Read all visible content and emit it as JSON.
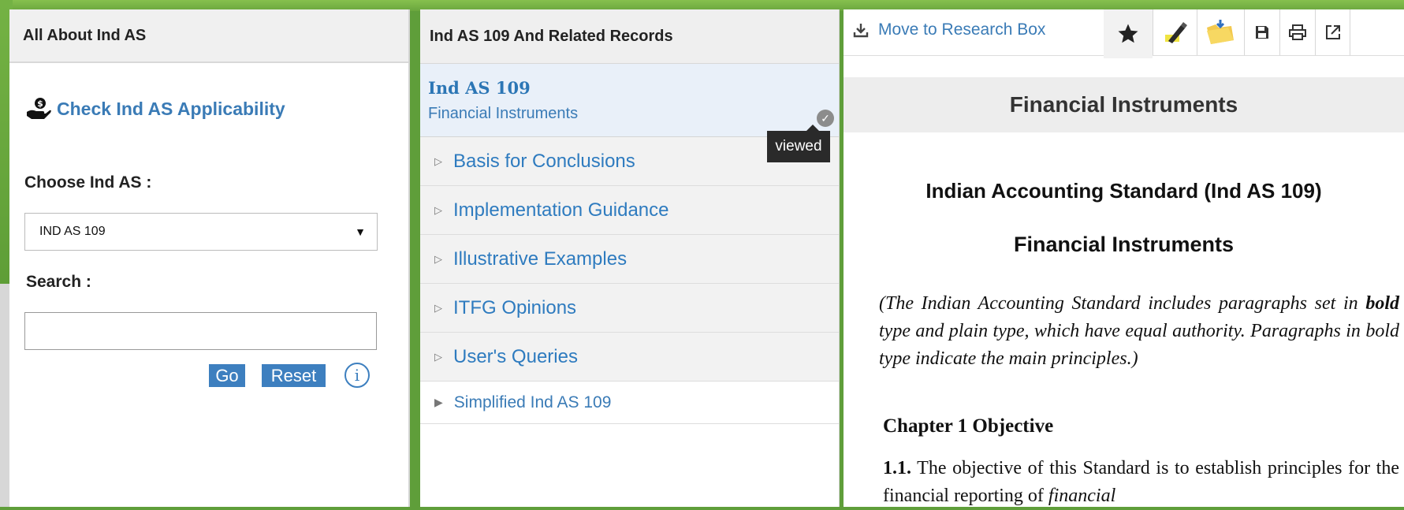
{
  "left_panel": {
    "header": "All About Ind AS",
    "check_link": "Check Ind AS Applicability",
    "choose_label": "Choose Ind AS :",
    "selected_standard": "IND AS 109",
    "search_label": "Search :",
    "search_value": "",
    "go_label": "Go",
    "reset_label": "Reset"
  },
  "middle_panel": {
    "header": "Ind AS 109 And Related Records",
    "active_item": {
      "code": "Ind AS 109",
      "title": "Financial Instruments"
    },
    "tooltip": "viewed",
    "items": [
      "Basis for Conclusions",
      "Implementation Guidance",
      "Illustrative Examples",
      "ITFG Opinions",
      "User's Queries"
    ],
    "last_item": "Simplified Ind AS 109"
  },
  "right_panel": {
    "move_link": "Move to Research Box",
    "toolbar_icons": [
      "star-icon",
      "highlighter-icon",
      "folder-icon",
      "save-icon",
      "print-icon",
      "external-link-icon"
    ],
    "title": "Financial Instruments",
    "doc_heading": "Indian Accounting Standard (Ind AS 109)",
    "doc_subheading": "Financial Instruments",
    "intro_part1": "(The Indian Accounting Standard includes paragraphs set in ",
    "intro_bold": "bold",
    "intro_part2": " type and plain type, which have equal authority. Paragraphs in bold type indicate the main principles.)",
    "chapter": "Chapter 1 Objective",
    "para_num": "1.1.",
    "para_text": " The objective of this Standard is to establish principles for the financial reporting of ",
    "para_italic": "financial"
  },
  "colors": {
    "link_blue": "#3a7bb6",
    "button_blue": "#3d7fbf",
    "background_green": "#5f9e3a",
    "active_row": "#e9f0f9"
  }
}
